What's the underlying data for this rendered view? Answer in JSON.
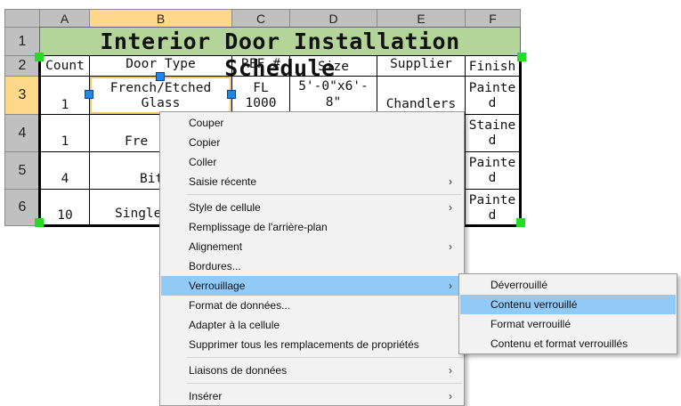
{
  "spreadsheet": {
    "columns": [
      "A",
      "B",
      "C",
      "D",
      "E",
      "F"
    ],
    "rows": [
      "1",
      "2",
      "3",
      "4",
      "5",
      "6"
    ],
    "title": "Interior Door Installation Schedule",
    "headers": {
      "count": "Count",
      "door_type": "Door Type",
      "ref": "REF #",
      "size": "Size",
      "supplier": "Supplier",
      "finish": "Finish"
    },
    "row3": {
      "count": "1",
      "door_type_l1": "French/Etched",
      "door_type_l2": "Glass",
      "ref_l1": "FL",
      "ref_l2": "1000",
      "size_l1": "5'-0\"x6'-",
      "size_l2": "8\"",
      "supplier": "Chandlers",
      "finish_l1": "Painte",
      "finish_l2": "d"
    },
    "row4": {
      "count": "1",
      "door_type": "Fre",
      "finish_l1": "Staine",
      "finish_l2": "d"
    },
    "row5": {
      "count": "4",
      "door_type": "Bit",
      "finish_l1": "Painte",
      "finish_l2": "d"
    },
    "row6": {
      "count": "10",
      "door_type": "Single",
      "finish_l1": "Painte",
      "finish_l2": "d"
    }
  },
  "context_menu": {
    "items": [
      {
        "label": "Couper",
        "submenu": false
      },
      {
        "label": "Copier",
        "submenu": false
      },
      {
        "label": "Coller",
        "submenu": false
      },
      {
        "label": "Saisie récente",
        "submenu": true
      },
      {
        "label": "Style de cellule",
        "submenu": true
      },
      {
        "label": "Remplissage de l'arrière-plan",
        "submenu": false
      },
      {
        "label": "Alignement",
        "submenu": true
      },
      {
        "label": "Bordures...",
        "submenu": false
      },
      {
        "label": "Verrouillage",
        "submenu": true,
        "highlighted": true
      },
      {
        "label": "Format de données...",
        "submenu": false
      },
      {
        "label": "Adapter à la cellule",
        "submenu": false
      },
      {
        "label": "Supprimer tous les remplacements de propriétés",
        "submenu": false
      },
      {
        "label": "Liaisons de données",
        "submenu": true
      },
      {
        "label": "Insérer",
        "submenu": true
      }
    ],
    "arrow_glyph": "›"
  },
  "submenu": {
    "items": [
      {
        "label": "Déverrouillé"
      },
      {
        "label": "Contenu verrouillé",
        "highlighted": true
      },
      {
        "label": "Format verrouillé"
      },
      {
        "label": "Contenu et format verrouillés"
      }
    ]
  },
  "colors": {
    "title_fill": "#b4d59a",
    "selected_header": "#ffd88a",
    "grip_blue": "#1e88e5",
    "grip_green": "#22dd22",
    "menu_highlight": "#91c9f7"
  }
}
